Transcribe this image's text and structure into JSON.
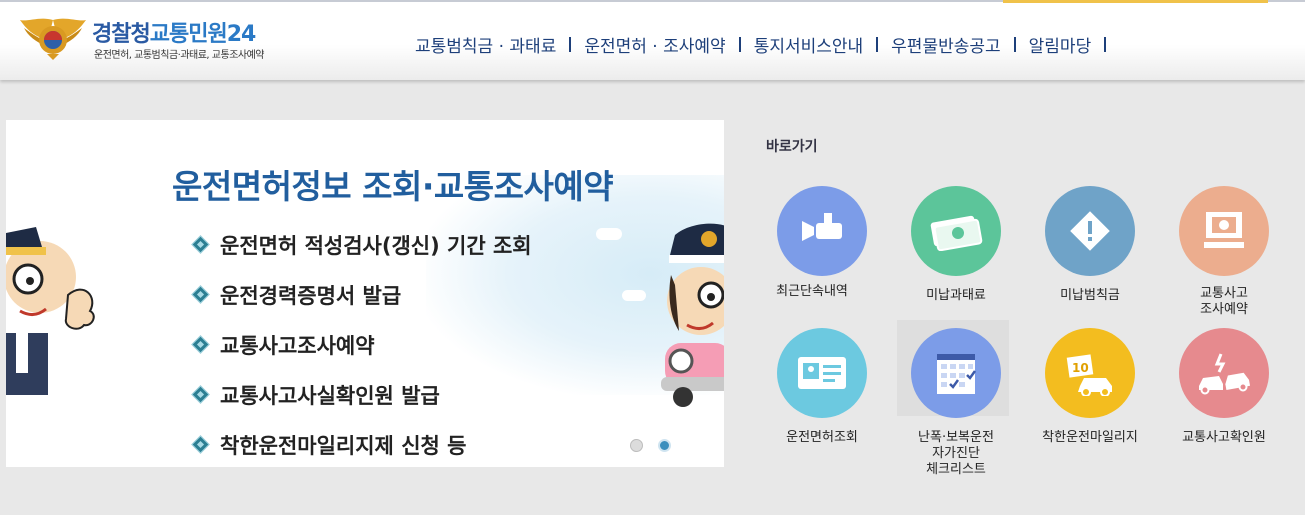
{
  "header": {
    "logo": {
      "title_main": "경찰청",
      "title_sub": "교통민원24",
      "tagline": "운전면허, 교통범칙금·과태료, 교통조사예약",
      "emblem": "police-emblem"
    },
    "nav": [
      {
        "label": "교통범칙금 · 과태료"
      },
      {
        "label": "운전면허 · 조사예약"
      },
      {
        "label": "통지서비스안내"
      },
      {
        "label": "우편물반송공고"
      },
      {
        "label": "알림마당"
      }
    ]
  },
  "banner": {
    "title": "운전면허정보 조회·교통조사예약",
    "items": [
      "운전면허 적성검사(갱신) 기간 조회",
      "운전경력증명서 발급",
      "교통사고조사예약",
      "교통사고사실확인원 발급",
      "착한운전마일리지제 신청 등"
    ],
    "slide_current": 2,
    "slide_total": 2
  },
  "quick": {
    "title": "바로가기",
    "items": [
      {
        "label": "최근단속내역",
        "icon": "cctv-camera-icon",
        "color": "#7c9ce8"
      },
      {
        "label": "미납과태료",
        "icon": "banknote-icon",
        "color": "#5cc59a"
      },
      {
        "label": "미납범칙금",
        "icon": "warning-sign-icon",
        "color": "#6fa3c8"
      },
      {
        "label": "교통사고\n조사예약",
        "icon": "monitor-icon",
        "color": "#ecad8e"
      },
      {
        "label": "운전면허조회",
        "icon": "license-card-icon",
        "color": "#6cc9e0"
      },
      {
        "label": "난폭·보복운전\n자가진단\n체크리스트",
        "icon": "checklist-calendar-icon",
        "color": "#7c9ce8"
      },
      {
        "label": "착한운전마일리지",
        "icon": "mileage-car-icon",
        "color": "#f3bd1f"
      },
      {
        "label": "교통사고확인원",
        "icon": "car-crash-icon",
        "color": "#e68a8e"
      }
    ]
  }
}
